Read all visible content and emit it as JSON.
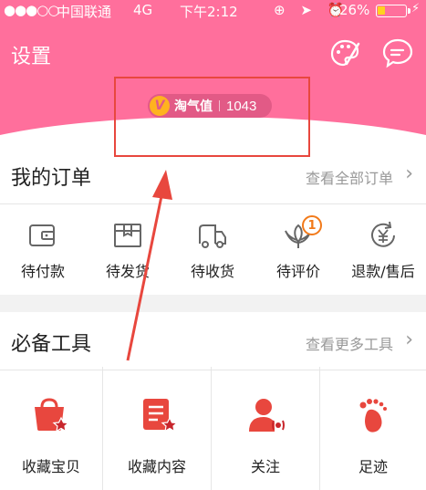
{
  "status_bar": {
    "signal": "●●●○○",
    "carrier": "中国联通",
    "network": "4G",
    "time": "下午2:12",
    "icons": "⊕ ➤ ⏰",
    "battery": "26%"
  },
  "header": {
    "settings_label": "设置",
    "skin_icon": "palette-icon",
    "message_icon": "chat-bubble-icon",
    "tqz_badge": "V",
    "tqz_label": "淘气值",
    "tqz_value": "1043"
  },
  "orders": {
    "title": "我的订单",
    "more_label": "查看全部订单",
    "chevron": "›",
    "items": [
      {
        "label": "待付款",
        "icon": "wallet-icon"
      },
      {
        "label": "待发货",
        "icon": "box-icon"
      },
      {
        "label": "待收货",
        "icon": "truck-icon"
      },
      {
        "label": "待评价",
        "icon": "lotus-icon",
        "badge": "1"
      },
      {
        "label": "退款/售后",
        "icon": "refund-icon"
      }
    ]
  },
  "tools": {
    "title": "必备工具",
    "more_label": "查看更多工具",
    "chevron": "›",
    "items": [
      {
        "label": "收藏宝贝",
        "icon": "favorite-bag-icon"
      },
      {
        "label": "收藏内容",
        "icon": "favorite-content-icon"
      },
      {
        "label": "关注",
        "icon": "follow-person-icon"
      },
      {
        "label": "足迹",
        "icon": "footprint-icon"
      }
    ]
  },
  "colors": {
    "header_pink": "#ff6f9c",
    "accent_red": "#e8473e",
    "badge_orange": "#f27a1a"
  }
}
